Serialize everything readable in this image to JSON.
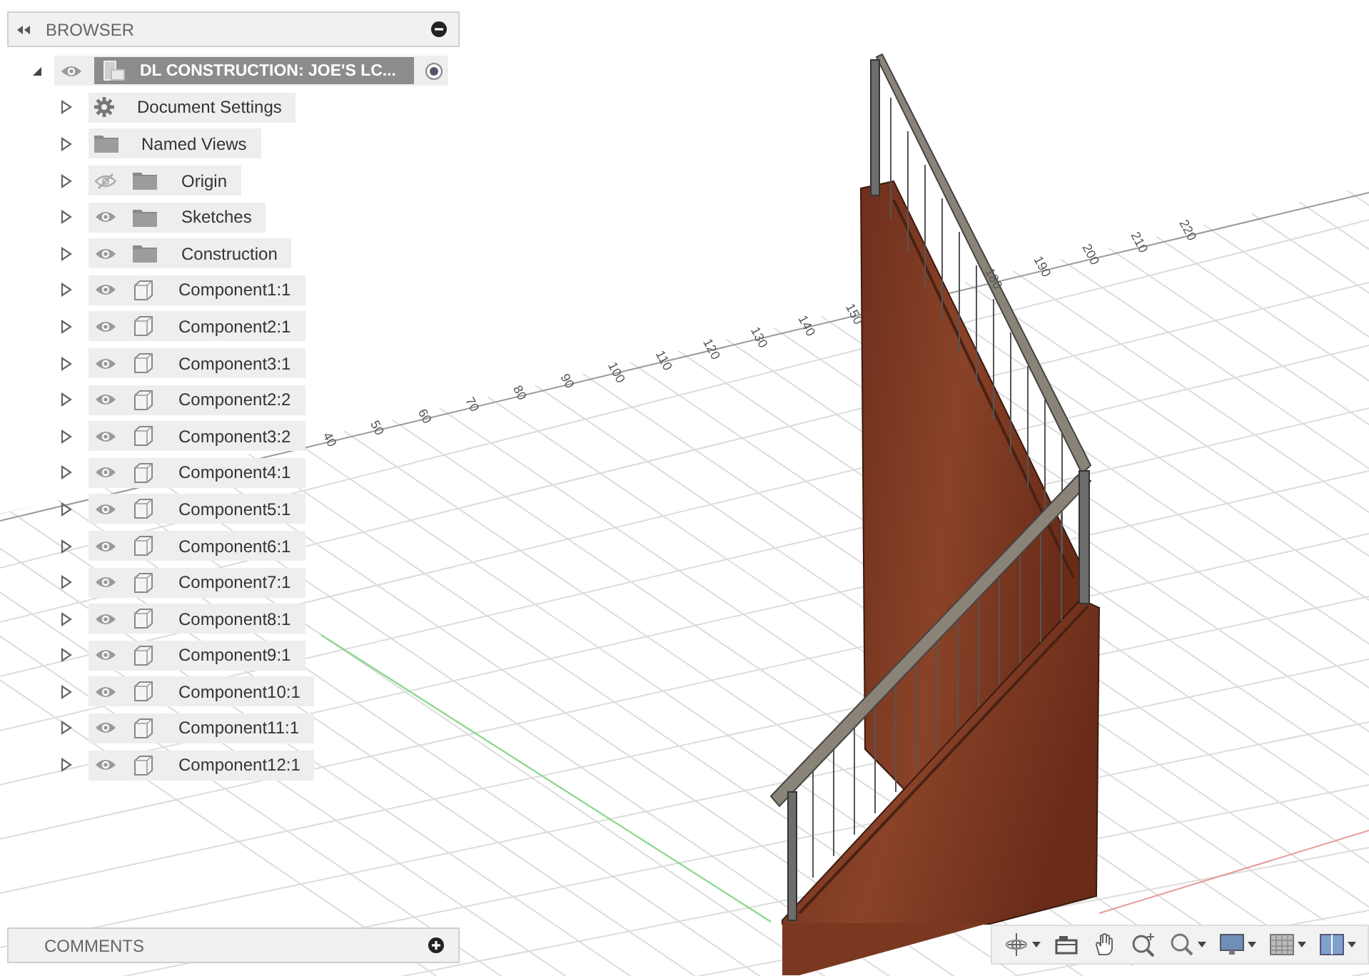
{
  "browser": {
    "title": "BROWSER",
    "root": {
      "label": "DL CONSTRUCTION: JOE'S LC...",
      "expanded": true,
      "visible": true,
      "active": true,
      "children": [
        {
          "kind": "settings",
          "label": "Document Settings",
          "expanded": false
        },
        {
          "kind": "folder",
          "label": "Named Views",
          "expanded": false
        },
        {
          "kind": "folder",
          "label": "Origin",
          "expanded": false,
          "visible": false
        },
        {
          "kind": "folder",
          "label": "Sketches",
          "expanded": false,
          "visible": true
        },
        {
          "kind": "folder",
          "label": "Construction",
          "expanded": false,
          "visible": true
        },
        {
          "kind": "component",
          "label": "Component1:1",
          "expanded": false,
          "visible": true
        },
        {
          "kind": "component",
          "label": "Component2:1",
          "expanded": false,
          "visible": true
        },
        {
          "kind": "component",
          "label": "Component3:1",
          "expanded": false,
          "visible": true
        },
        {
          "kind": "component",
          "label": "Component2:2",
          "expanded": false,
          "visible": true
        },
        {
          "kind": "component",
          "label": "Component3:2",
          "expanded": false,
          "visible": true
        },
        {
          "kind": "component",
          "label": "Component4:1",
          "expanded": false,
          "visible": true
        },
        {
          "kind": "component",
          "label": "Component5:1",
          "expanded": false,
          "visible": true
        },
        {
          "kind": "component",
          "label": "Component6:1",
          "expanded": false,
          "visible": true
        },
        {
          "kind": "component",
          "label": "Component7:1",
          "expanded": false,
          "visible": true
        },
        {
          "kind": "component",
          "label": "Component8:1",
          "expanded": false,
          "visible": true
        },
        {
          "kind": "component",
          "label": "Component9:1",
          "expanded": false,
          "visible": true
        },
        {
          "kind": "component",
          "label": "Component10:1",
          "expanded": false,
          "visible": true
        },
        {
          "kind": "component",
          "label": "Component11:1",
          "expanded": false,
          "visible": true
        },
        {
          "kind": "component",
          "label": "Component12:1",
          "expanded": false,
          "visible": true
        }
      ]
    }
  },
  "viewport": {
    "ruler_labels": [
      "40",
      "50",
      "60",
      "70",
      "80",
      "90",
      "100",
      "110",
      "120",
      "130",
      "140",
      "150",
      "180",
      "190",
      "200",
      "210",
      "220"
    ]
  },
  "comments": {
    "title": "COMMENTS"
  },
  "nav_toolbar": [
    {
      "kind": "orbit",
      "has_menu": true
    },
    {
      "kind": "look",
      "has_menu": false
    },
    {
      "kind": "pan",
      "has_menu": false
    },
    {
      "kind": "zoom",
      "has_menu": false
    },
    {
      "kind": "fit",
      "has_menu": true
    },
    {
      "kind": "display",
      "has_menu": true
    },
    {
      "kind": "grid",
      "has_menu": true
    },
    {
      "kind": "viewports",
      "has_menu": true
    }
  ]
}
